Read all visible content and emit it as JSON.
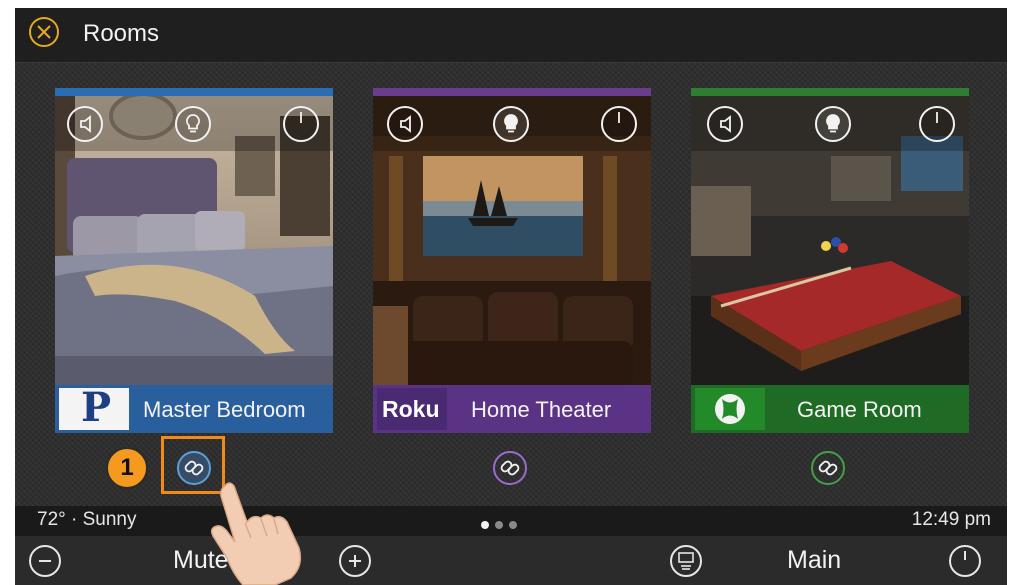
{
  "header": {
    "title": "Rooms"
  },
  "rooms": [
    {
      "name": "Master Bedroom",
      "source_badge": "P",
      "accent": "#2a6db2"
    },
    {
      "name": "Home Theater",
      "source_badge": "Roku",
      "accent": "#6a3c8e"
    },
    {
      "name": "Game Room",
      "source_badge": "xbox-icon",
      "accent": "#2e7d32"
    }
  ],
  "status_bar": {
    "weather": "72° · Sunny",
    "time": "12:49 pm",
    "page_count": 3,
    "active_page": 1
  },
  "bottom_bar": {
    "mute_label": "Mute",
    "main_label": "Main"
  },
  "annotation": {
    "step_number": "1",
    "highlight_color": "#f08a1a"
  }
}
